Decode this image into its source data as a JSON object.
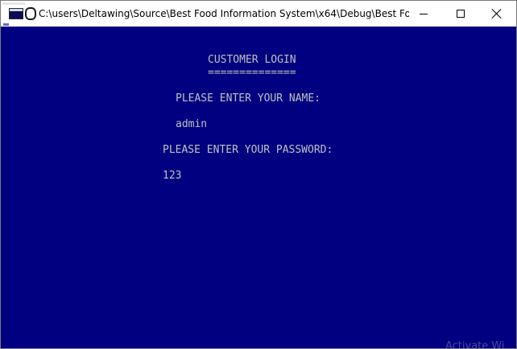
{
  "window": {
    "title": "C:\\users\\Deltawing\\Source\\Best Food Information System\\x64\\Debug\\Best Food Infor...",
    "icon": "console-app-icon",
    "controls": {
      "minimize_icon": "minimize-icon",
      "maximize_icon": "maximize-icon",
      "close_icon": "close-icon"
    }
  },
  "console": {
    "background": "#000080",
    "foreground": "#c0c0c0",
    "heading": "CUSTOMER LOGIN",
    "heading_underline": "==============",
    "name_prompt": "PLEASE ENTER YOUR NAME:",
    "name_value": "admin",
    "password_prompt": "PLEASE ENTER YOUR PASSWORD:",
    "password_value": "123"
  },
  "watermark": {
    "text": "Activate Wi"
  }
}
